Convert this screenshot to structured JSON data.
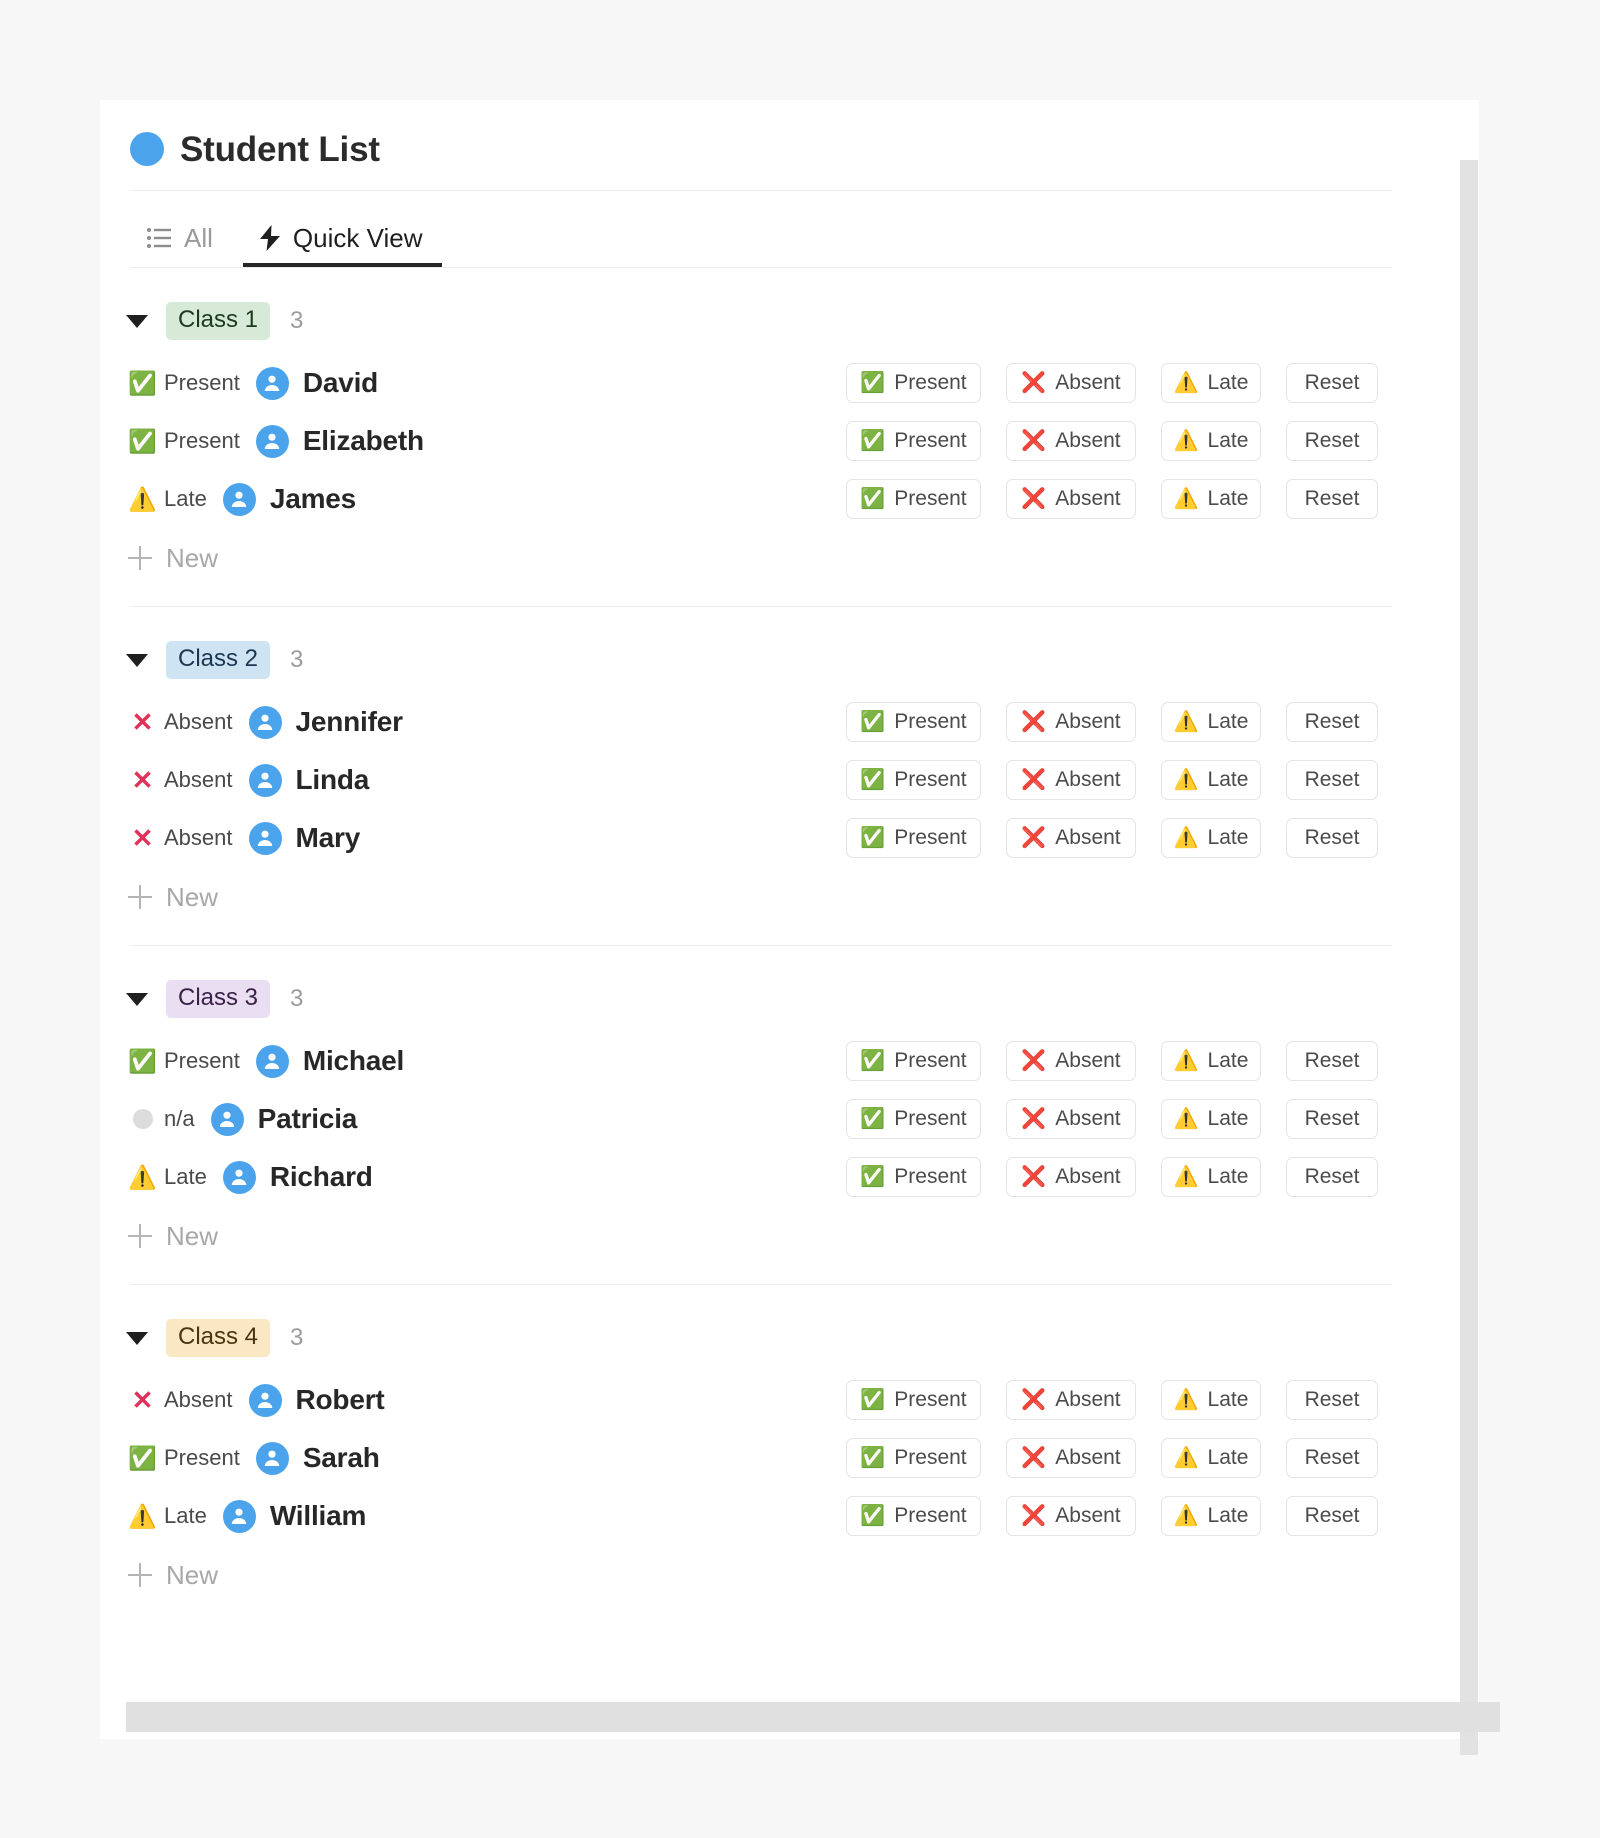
{
  "header": {
    "title": "Student List",
    "dot_color": "#4ba3ec"
  },
  "tabs": [
    {
      "label": "All",
      "icon": "list-icon",
      "active": false
    },
    {
      "label": "Quick View",
      "icon": "lightning-bolt-icon",
      "active": true
    }
  ],
  "row_actions": [
    {
      "key": "present",
      "label": "Present",
      "glyph": "✅",
      "icon": "green-check-box-icon"
    },
    {
      "key": "absent",
      "label": "Absent",
      "glyph": "❌",
      "icon": "red-cross-mark-icon"
    },
    {
      "key": "late",
      "label": "Late",
      "glyph": "⚠️",
      "icon": "warning-triangle-icon"
    },
    {
      "key": "reset",
      "label": "Reset",
      "glyph": "",
      "icon": ""
    }
  ],
  "new_row_label": "New",
  "statuses": {
    "present": {
      "label": "Present",
      "glyph": "✅",
      "color": "#4caf50"
    },
    "absent": {
      "label": "Absent",
      "glyph": "✕",
      "color": "#e0315b"
    },
    "late": {
      "label": "Late",
      "glyph": "⚠️",
      "color": "#f2c200"
    },
    "na": {
      "label": "n/a",
      "glyph": "●",
      "color": "#dcdcdc"
    }
  },
  "groups": [
    {
      "name": "Class 1",
      "count": "3",
      "chip_color": "green",
      "chip_hex": "#d7ead7",
      "expanded": true,
      "students": [
        {
          "name": "David",
          "status": "present"
        },
        {
          "name": "Elizabeth",
          "status": "present"
        },
        {
          "name": "James",
          "status": "late"
        }
      ]
    },
    {
      "name": "Class 2",
      "count": "3",
      "chip_color": "blue",
      "chip_hex": "#cfe4f3",
      "expanded": true,
      "students": [
        {
          "name": "Jennifer",
          "status": "absent"
        },
        {
          "name": "Linda",
          "status": "absent"
        },
        {
          "name": "Mary",
          "status": "absent"
        }
      ]
    },
    {
      "name": "Class 3",
      "count": "3",
      "chip_color": "purple",
      "chip_hex": "#eadef2",
      "expanded": true,
      "students": [
        {
          "name": "Michael",
          "status": "present"
        },
        {
          "name": "Patricia",
          "status": "na"
        },
        {
          "name": "Richard",
          "status": "late"
        }
      ]
    },
    {
      "name": "Class 4",
      "count": "3",
      "chip_color": "orange",
      "chip_hex": "#fae7c3",
      "expanded": true,
      "students": [
        {
          "name": "Robert",
          "status": "absent"
        },
        {
          "name": "Sarah",
          "status": "present"
        },
        {
          "name": "William",
          "status": "late"
        }
      ]
    }
  ]
}
